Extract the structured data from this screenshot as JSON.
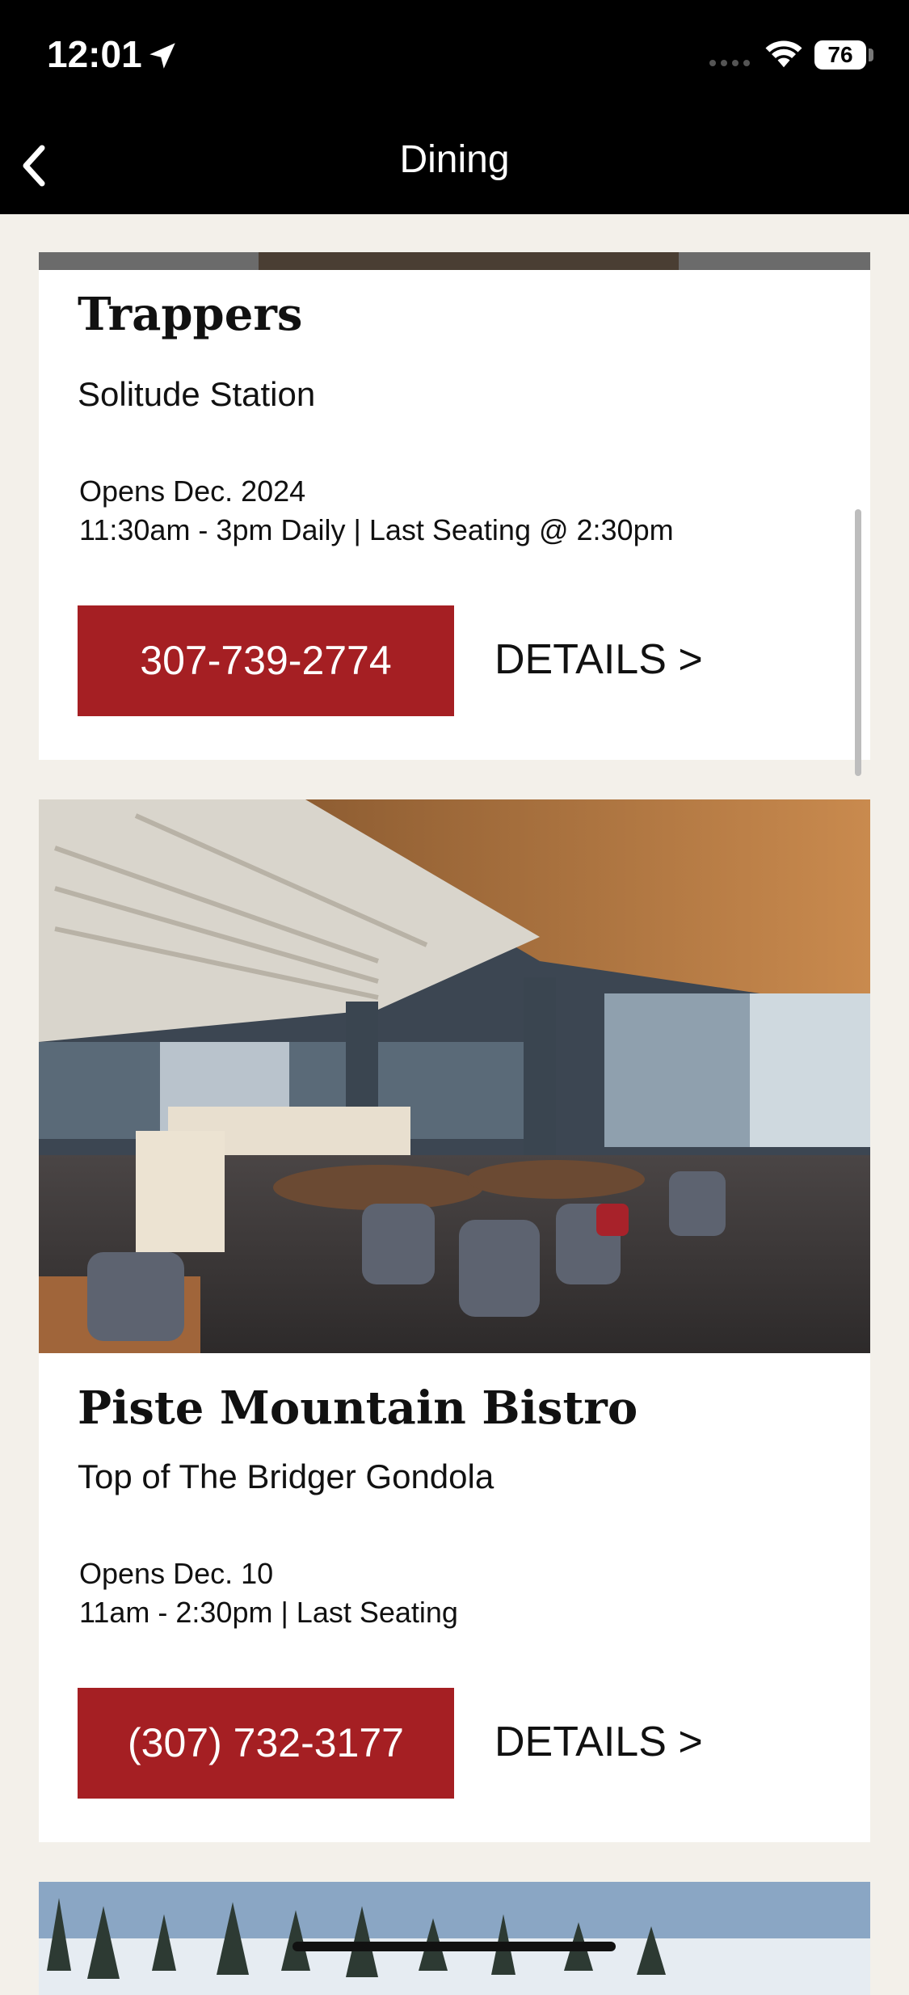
{
  "status": {
    "time": "12:01",
    "battery": "76"
  },
  "nav": {
    "title": "Dining"
  },
  "restaurants": [
    {
      "name": "Trappers",
      "location": "Solitude Station",
      "opens": "Opens Dec. 2024",
      "hours": "11:30am - 3pm Daily | Last Seating @ 2:30pm",
      "phone": "307-739-2774",
      "details": "DETAILS >"
    },
    {
      "name": "Piste Mountain Bistro",
      "location": "Top of The Bridger Gondola",
      "opens": "Opens Dec. 10",
      "hours": "11am - 2:30pm | Last Seating",
      "phone": "(307) 732-3177",
      "details": "DETAILS >"
    }
  ],
  "icons": {
    "back": "chevron-left-icon",
    "location": "location-arrow-icon",
    "wifi": "wifi-icon",
    "battery": "battery-icon"
  },
  "colors": {
    "accent": "#a51f23",
    "background": "#f3f0ea",
    "header": "#000000"
  }
}
